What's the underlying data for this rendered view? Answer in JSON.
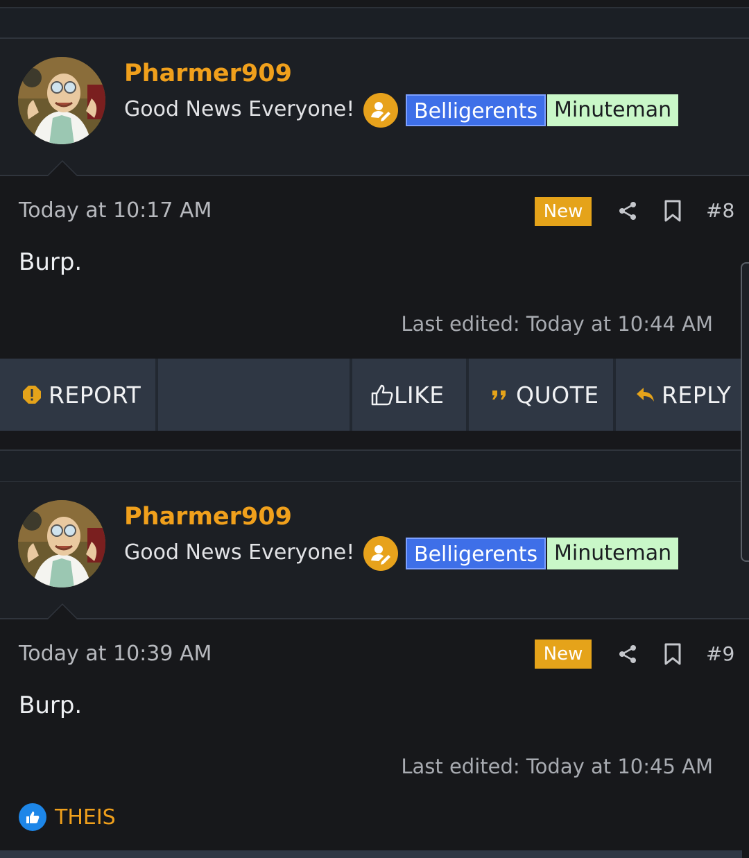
{
  "posts": [
    {
      "username": "Pharmer909",
      "user_title": "Good News Everyone!",
      "banner_blue": "Belligerents",
      "banner_green": "Minuteman",
      "date": "Today at 10:17 AM",
      "new_label": "New",
      "post_number": "#8",
      "body": "Burp.",
      "last_edited": "Last edited: Today at 10:44 AM"
    },
    {
      "username": "Pharmer909",
      "user_title": "Good News Everyone!",
      "banner_blue": "Belligerents",
      "banner_green": "Minuteman",
      "date": "Today at 10:39 AM",
      "new_label": "New",
      "post_number": "#9",
      "body": "Burp.",
      "last_edited": "Last edited: Today at 10:45 AM"
    }
  ],
  "actions": {
    "report": "REPORT",
    "like": "LIKE",
    "quote": "QUOTE",
    "reply": "REPLY"
  },
  "reactions": {
    "liked_by": "THEIS"
  },
  "colors": {
    "accent": "#f0a01c",
    "new_badge": "#e5a31a",
    "banner_blue": "#3e6fe8",
    "banner_green": "#c9f7c8",
    "action_bar": "#2f3744"
  },
  "icons": [
    "editor-icon",
    "share-icon",
    "bookmark-icon",
    "report-icon",
    "like-icon",
    "quote-icon",
    "reply-icon"
  ]
}
